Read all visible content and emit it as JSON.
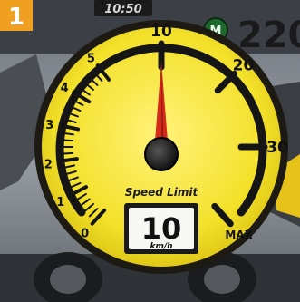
{
  "step_badge": "1",
  "hud": {
    "time": "10:50",
    "mode_badge": "M",
    "score_partial": "220"
  },
  "speedometer": {
    "caption": "Speed Limit",
    "tick_labels": [
      "0",
      "1",
      "2",
      "3",
      "4",
      "5",
      "10",
      "20",
      "30",
      "MAX"
    ],
    "needle_value": 10,
    "limit_value": "10",
    "limit_unit": "km/h",
    "colors": {
      "face": "#f3e12a",
      "bezel": "#1c1a12",
      "needle": "#d32a1a",
      "badge": "#f0a020"
    }
  }
}
